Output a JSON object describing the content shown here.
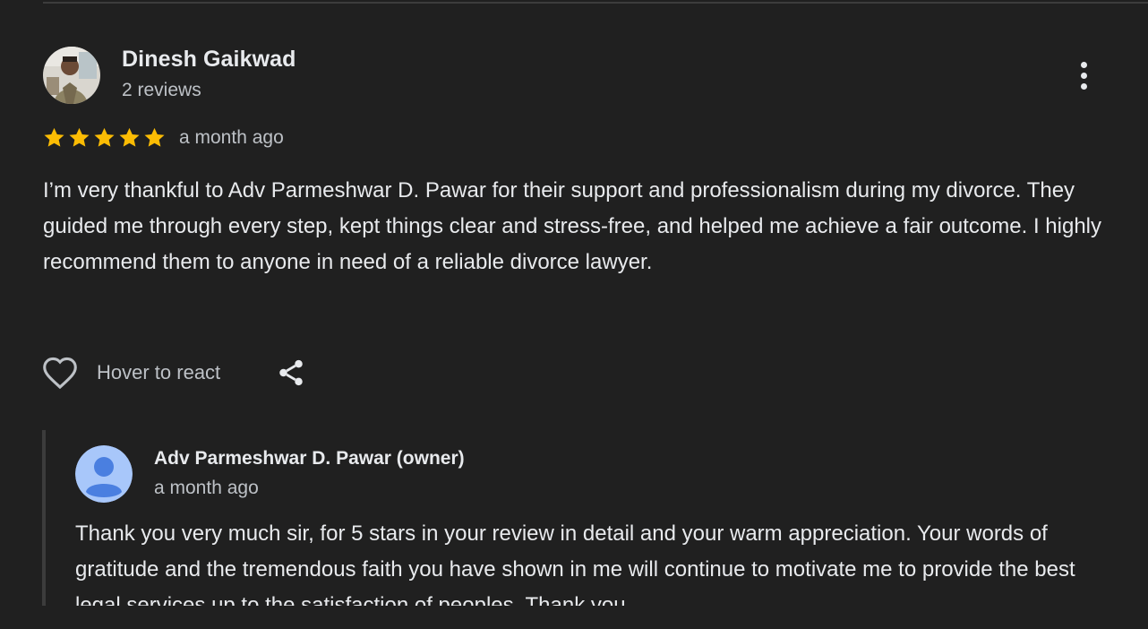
{
  "review": {
    "reviewer_name": "Dinesh Gaikwad",
    "reviewer_meta": "2 reviews",
    "rating": 5,
    "rating_max": 5,
    "star_color": "#fbbc04",
    "time": "a month ago",
    "text": "I’m very thankful to Adv Parmeshwar D. Pawar for their support and professionalism during my divorce. They guided me through every step, kept things clear and stress-free, and helped me achieve a fair outcome. I highly recommend them to anyone in need of a reliable divorce lawyer.",
    "react_label": "Hover to react",
    "icons": {
      "more": "more-vert-icon",
      "react": "heart-icon",
      "share": "share-icon"
    }
  },
  "reply": {
    "owner_name": "Adv Parmeshwar D. Pawar (owner)",
    "time": "a month ago",
    "text": "Thank you very much sir, for 5 stars in your review in detail and your warm appreciation. Your words of gratitude and the tremendous faith you have shown in me will continue to motivate me to provide the best legal services up to the satisfaction of peoples. Thank you",
    "avatar_bg": "#a8c7fa",
    "avatar_fg": "#4a7fe0"
  }
}
